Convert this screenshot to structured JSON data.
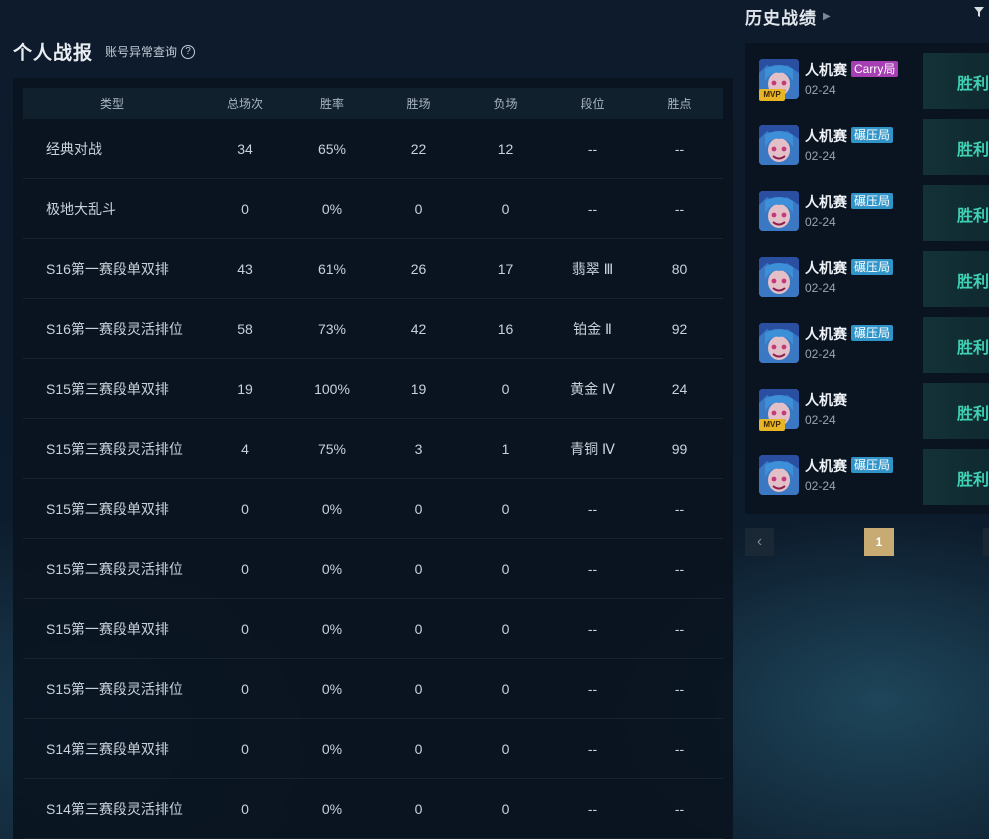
{
  "stats": {
    "title": "个人战报",
    "anomaly_link": "账号异常查询",
    "help": "?",
    "headers": [
      "类型",
      "总场次",
      "胜率",
      "胜场",
      "负场",
      "段位",
      "胜点"
    ],
    "rows": [
      [
        "经典对战",
        "34",
        "65%",
        "22",
        "12",
        "--",
        "--"
      ],
      [
        "极地大乱斗",
        "0",
        "0%",
        "0",
        "0",
        "--",
        "--"
      ],
      [
        "S16第一赛段单双排",
        "43",
        "61%",
        "26",
        "17",
        "翡翠 Ⅲ",
        "80"
      ],
      [
        "S16第一赛段灵活排位",
        "58",
        "73%",
        "42",
        "16",
        "铂金 Ⅱ",
        "92"
      ],
      [
        "S15第三赛段单双排",
        "19",
        "100%",
        "19",
        "0",
        "黄金 Ⅳ",
        "24"
      ],
      [
        "S15第三赛段灵活排位",
        "4",
        "75%",
        "3",
        "1",
        "青铜 Ⅳ",
        "99"
      ],
      [
        "S15第二赛段单双排",
        "0",
        "0%",
        "0",
        "0",
        "--",
        "--"
      ],
      [
        "S15第二赛段灵活排位",
        "0",
        "0%",
        "0",
        "0",
        "--",
        "--"
      ],
      [
        "S15第一赛段单双排",
        "0",
        "0%",
        "0",
        "0",
        "--",
        "--"
      ],
      [
        "S15第一赛段灵活排位",
        "0",
        "0%",
        "0",
        "0",
        "--",
        "--"
      ],
      [
        "S14第三赛段单双排",
        "0",
        "0%",
        "0",
        "0",
        "--",
        "--"
      ],
      [
        "S14第三赛段灵活排位",
        "0",
        "0%",
        "0",
        "0",
        "--",
        "--"
      ]
    ]
  },
  "history": {
    "title": "历史战绩",
    "arrow_icon": "chevron-right-icon",
    "filter_icon": "filter-icon",
    "matches": [
      {
        "mode": "人机赛",
        "tag": "Carry局",
        "tag_type": "carry",
        "mvp": "MVP",
        "date": "02-24",
        "result": "胜利"
      },
      {
        "mode": "人机赛",
        "tag": "碾压局",
        "tag_type": "crush",
        "mvp": "",
        "date": "02-24",
        "result": "胜利"
      },
      {
        "mode": "人机赛",
        "tag": "碾压局",
        "tag_type": "crush",
        "mvp": "",
        "date": "02-24",
        "result": "胜利"
      },
      {
        "mode": "人机赛",
        "tag": "碾压局",
        "tag_type": "crush",
        "mvp": "",
        "date": "02-24",
        "result": "胜利"
      },
      {
        "mode": "人机赛",
        "tag": "碾压局",
        "tag_type": "crush",
        "mvp": "",
        "date": "02-24",
        "result": "胜利"
      },
      {
        "mode": "人机赛",
        "tag": "",
        "tag_type": "",
        "mvp": "MVP",
        "date": "02-24",
        "result": "胜利"
      },
      {
        "mode": "人机赛",
        "tag": "碾压局",
        "tag_type": "crush",
        "mvp": "",
        "date": "02-24",
        "result": "胜利"
      }
    ],
    "pager": {
      "prev": "‹",
      "current": "1"
    }
  },
  "colors": {
    "win": "#3fd0b3",
    "carry_tag": "#a63fb3",
    "crush_tag": "#3094c8",
    "mvp": "#e7b526",
    "page_active": "#c8ab72"
  }
}
